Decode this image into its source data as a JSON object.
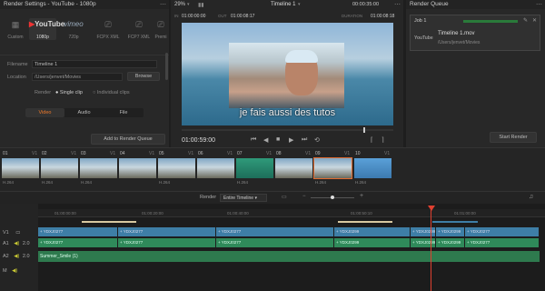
{
  "render_settings": {
    "title": "Render Settings - YouTube - 1080p",
    "presets": [
      {
        "label": "Custom",
        "icon": "film-icon"
      },
      {
        "label": "1080p",
        "icon": "youtube-logo"
      },
      {
        "label": "720p",
        "icon": "vimeo-logo"
      },
      {
        "label": "FCPX XML",
        "icon": "fcpx-icon"
      },
      {
        "label": "FCP7 XML",
        "icon": "fcp7-icon"
      },
      {
        "label": "Premi",
        "icon": "premiere-icon"
      }
    ],
    "youtube_logo": "YouTube",
    "vimeo_logo": "vimeo",
    "filename_label": "Filename",
    "filename_value": "Timeline 1",
    "location_label": "Location",
    "location_value": "/Users/jenvet/Movies",
    "browse_label": "Browse",
    "render_label": "Render",
    "single_clip": "Single clip",
    "individual_clips": "Individual clips",
    "tabs": [
      "Video",
      "Audio",
      "File"
    ],
    "add_queue_label": "Add to Render Queue"
  },
  "viewer": {
    "zoom": "29%",
    "in_label": "IN",
    "in_tc": "01:00:00:00",
    "out_label": "OUT",
    "out_tc": "01:00:08:17",
    "timeline_name": "Timeline 1",
    "duration_tc": "00:00:35:00",
    "duration_label": "DURATION",
    "duration_value": "01:00:08:18",
    "subtitle": "je fais aussi des tutos",
    "current_tc": "01:00:59:00"
  },
  "render_queue": {
    "title": "Render Queue",
    "job_label": "Job 1",
    "job_file": "Timeline 1.mov",
    "job_path": "/Users/jenvet/Movies",
    "start_render_label": "Start Render"
  },
  "clips": [
    {
      "num": "01",
      "track": "V1",
      "codec": "H.264"
    },
    {
      "num": "02",
      "track": "V1",
      "codec": "H.264"
    },
    {
      "num": "03",
      "track": "V1",
      "codec": "H.264"
    },
    {
      "num": "04",
      "track": "V1",
      "codec": ""
    },
    {
      "num": "05",
      "track": "V1",
      "codec": "H.264"
    },
    {
      "num": "06",
      "track": "V1",
      "codec": ""
    },
    {
      "num": "07",
      "track": "V1",
      "codec": "H.264"
    },
    {
      "num": "08",
      "track": "V1",
      "codec": ""
    },
    {
      "num": "09",
      "track": "V1",
      "codec": "H.264"
    },
    {
      "num": "10",
      "track": "V1",
      "codec": "H.264"
    }
  ],
  "timeline": {
    "render_label": "Render",
    "render_range": "Entire Timeline",
    "ruler": [
      "01:00:00:00",
      "01:00:20:00",
      "01:00:40:00",
      "01:00:50:10",
      "01:01:00:00"
    ],
    "tracks": {
      "v1": "V1",
      "a1": "A1",
      "a2": "A2",
      "m": "M"
    },
    "level": "2.0",
    "v1_clips": [
      "YDXJ0277",
      "YDXJ0277",
      "YDXJ0277",
      "YDXJ0299",
      "YDXJ0299",
      "YDXJ0299",
      "YDXJ0277"
    ],
    "a1_clips": [
      "YDXJ0277",
      "YDXJ0277",
      "YDXJ0277",
      "YDXJ0299",
      "YDXJ0299",
      "YDXJ0299",
      "YDXJ0277"
    ],
    "music_clip": "Summer_Smile (1)"
  }
}
